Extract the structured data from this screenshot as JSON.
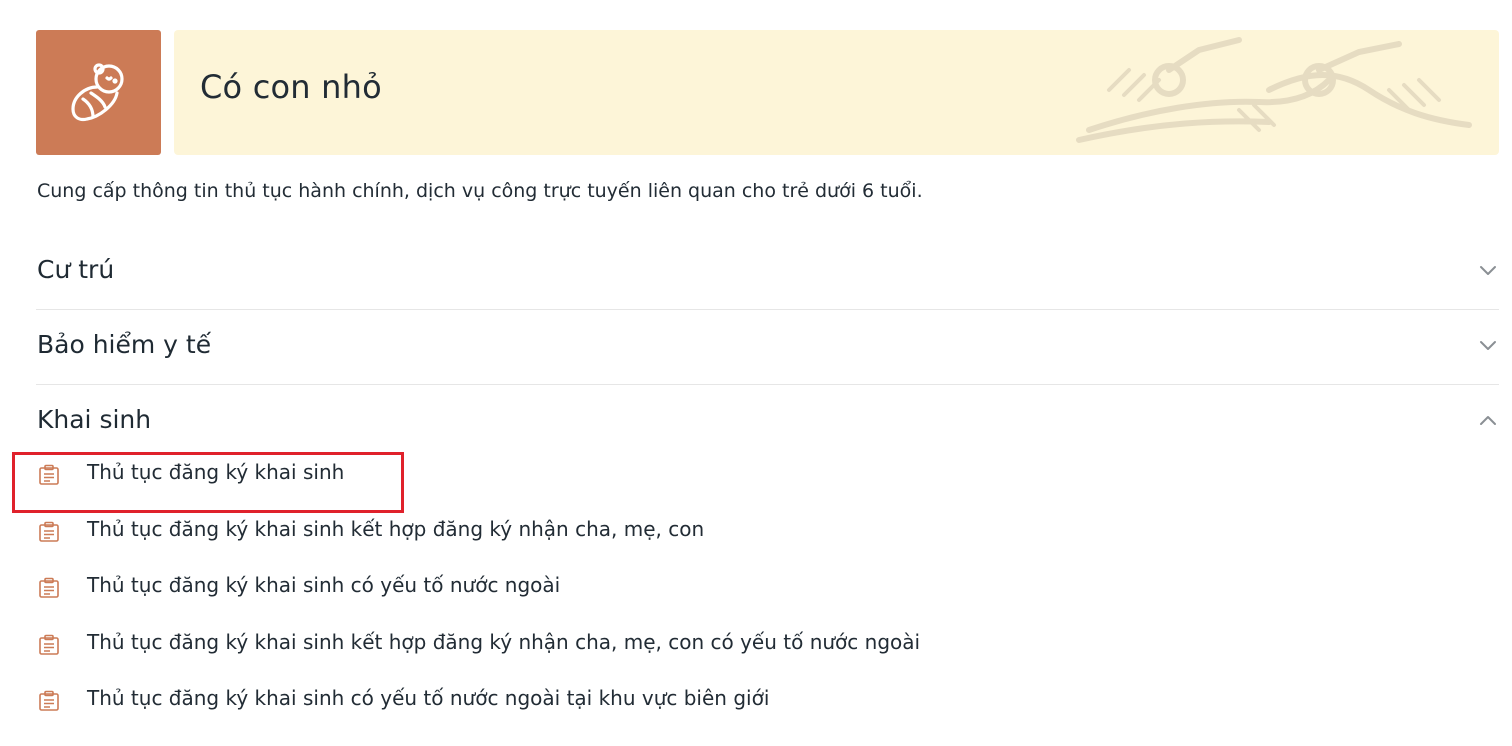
{
  "header": {
    "title": "Có con nhỏ",
    "icon": "baby-icon",
    "icon_bg_color": "#cc7b56",
    "banner_bg_color": "#fdf5d8"
  },
  "description": "Cung cấp thông tin thủ tục hành chính, dịch vụ công trực tuyến liên quan cho trẻ dưới 6 tuổi.",
  "accordion": {
    "sections": [
      {
        "title": "Cư trú",
        "expanded": false
      },
      {
        "title": "Bảo hiểm y tế",
        "expanded": false
      },
      {
        "title": "Khai sinh",
        "expanded": true
      }
    ],
    "khai_sinh_items": [
      {
        "label": "Thủ tục đăng ký khai sinh",
        "highlighted": true
      },
      {
        "label": "Thủ tục đăng ký khai sinh kết hợp đăng ký nhận cha, mẹ, con"
      },
      {
        "label": "Thủ tục đăng ký khai sinh có yếu tố nước ngoài"
      },
      {
        "label": "Thủ tục đăng ký khai sinh kết hợp đăng ký nhận cha, mẹ, con có yếu tố nước ngoài"
      },
      {
        "label": "Thủ tục đăng ký khai sinh có yếu tố nước ngoài tại khu vực biên giới"
      }
    ]
  },
  "colors": {
    "accent": "#cc7b56",
    "highlight": "#e0212b"
  }
}
